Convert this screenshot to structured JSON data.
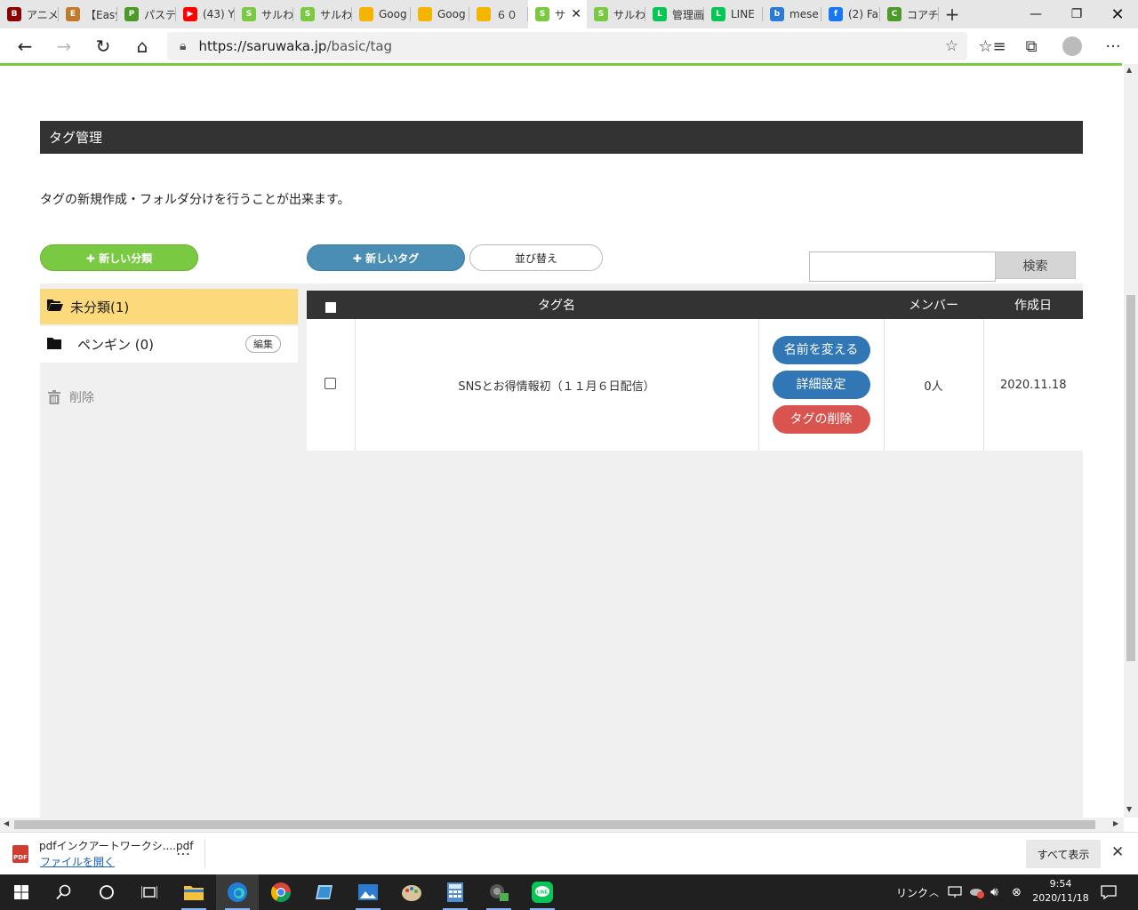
{
  "browser": {
    "tabs": [
      {
        "title": "アニメ",
        "icon_color": "#8b0000",
        "icon_label": "B"
      },
      {
        "title": "【Easy",
        "icon_color": "#c07a2a",
        "icon_label": "E"
      },
      {
        "title": "パステ",
        "icon_color": "#4c9a2a",
        "icon_label": "P"
      },
      {
        "title": "(43) Y",
        "icon_color": "#ff0000",
        "icon_label": "▶"
      },
      {
        "title": "サルわ",
        "icon_color": "#7ac943",
        "icon_label": "S"
      },
      {
        "title": "サルわ",
        "icon_color": "#7ac943",
        "icon_label": "S"
      },
      {
        "title": "Goog",
        "icon_color": "#f4b400",
        "icon_label": ""
      },
      {
        "title": "Goog",
        "icon_color": "#f4b400",
        "icon_label": ""
      },
      {
        "title": "６０",
        "icon_color": "#f4b400",
        "icon_label": ""
      },
      {
        "title": "サ",
        "icon_color": "#7ac943",
        "icon_label": "S",
        "active": true
      },
      {
        "title": "サルわ",
        "icon_color": "#7ac943",
        "icon_label": "S"
      },
      {
        "title": "管理画",
        "icon_color": "#06c755",
        "icon_label": "L"
      },
      {
        "title": "LINE",
        "icon_color": "#06c755",
        "icon_label": "L"
      },
      {
        "title": "mese",
        "icon_color": "#2a7ad6",
        "icon_label": "b"
      },
      {
        "title": "(2) Fa",
        "icon_color": "#1877f2",
        "icon_label": "f"
      },
      {
        "title": "コアチ",
        "icon_color": "#4c9a2a",
        "icon_label": "C"
      }
    ],
    "url_domain": "https://saruwaka.jp",
    "url_path": "/basic/tag"
  },
  "page": {
    "section_title": "タグ管理",
    "description": "タグの新規作成・フォルダ分けを行うことが出来ます。",
    "new_category_label": "✚ 新しい分類",
    "new_tag_label": "✚ 新しいタグ",
    "sort_label": "並び替え",
    "search_placeholder": "",
    "search_button": "検索",
    "categories": [
      {
        "label": "未分類(1)",
        "selected": true
      },
      {
        "label": "ペンギン (0)",
        "edit_label": "編集"
      }
    ],
    "delete_label": "削除",
    "table": {
      "headers": [
        "",
        "タグ名",
        "",
        "メンバー",
        "作成日"
      ],
      "rows": [
        {
          "name": "SNSとお得情報初（１１月６日配信）",
          "actions": [
            "名前を変える",
            "詳細設定",
            "タグの削除"
          ],
          "members": "0人",
          "created": "2020.11.18"
        }
      ]
    }
  },
  "download_bar": {
    "filename": "pdfインクアートワークシ....pdf",
    "open_label": "ファイルを開く",
    "more": "…",
    "show_all": "すべて表示"
  },
  "taskbar": {
    "tray_link": "リンク",
    "time": "9:54",
    "date": "2020/11/18"
  },
  "colors": {
    "accent_green": "#7ac943",
    "header_dark": "#333333",
    "selected_category": "#fcd97a",
    "button_blue": "#3277b5",
    "button_red": "#d9534f"
  }
}
